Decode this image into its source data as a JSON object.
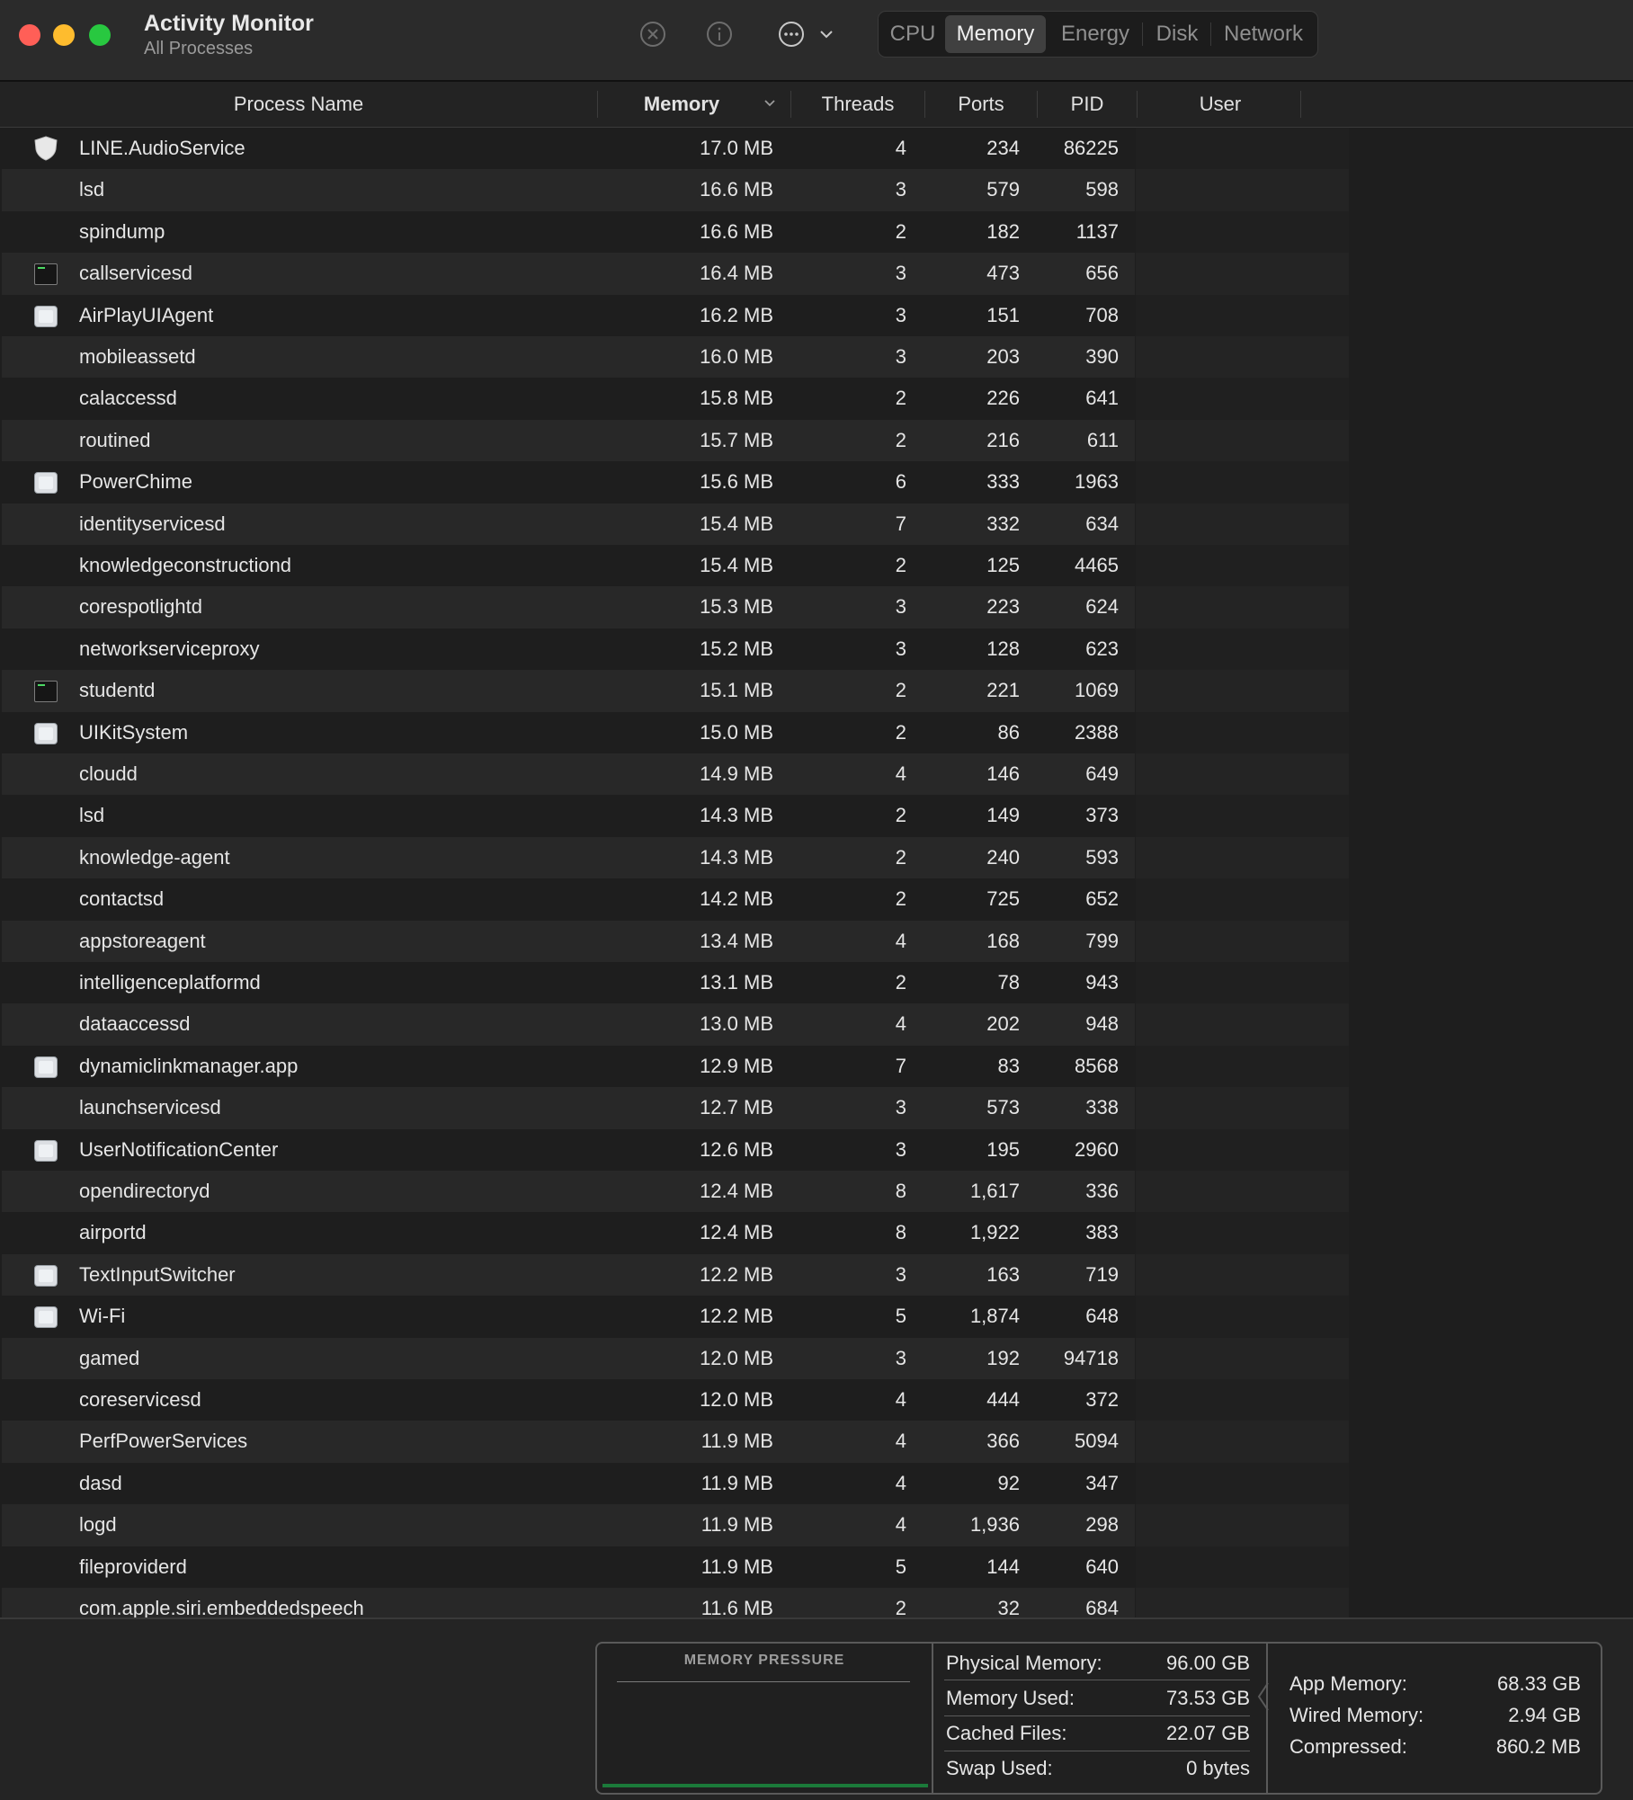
{
  "window": {
    "title": "Activity Monitor",
    "subtitle": "All Processes"
  },
  "toolbar": {
    "icons": [
      "stop-process-icon",
      "info-icon",
      "more-options-icon",
      "chevron-down-icon"
    ],
    "tabs": [
      {
        "label": "CPU",
        "active": false
      },
      {
        "label": "Memory",
        "active": true
      },
      {
        "label": "Energy",
        "active": false
      },
      {
        "label": "Disk",
        "active": false
      },
      {
        "label": "Network",
        "active": false
      }
    ]
  },
  "columns": {
    "name": "Process Name",
    "memory": "Memory",
    "threads": "Threads",
    "ports": "Ports",
    "pid": "PID",
    "user": "User"
  },
  "processes": [
    {
      "name": "LINE.AudioService",
      "icon": "shield-icon",
      "memory": "17.0 MB",
      "threads": "4",
      "ports": "234",
      "pid": "86225"
    },
    {
      "name": "lsd",
      "icon": "",
      "memory": "16.6 MB",
      "threads": "3",
      "ports": "579",
      "pid": "598"
    },
    {
      "name": "spindump",
      "icon": "",
      "memory": "16.6 MB",
      "threads": "2",
      "ports": "182",
      "pid": "1137"
    },
    {
      "name": "callservicesd",
      "icon": "terminal-icon",
      "memory": "16.4 MB",
      "threads": "3",
      "ports": "473",
      "pid": "656"
    },
    {
      "name": "AirPlayUIAgent",
      "icon": "app-icon",
      "memory": "16.2 MB",
      "threads": "3",
      "ports": "151",
      "pid": "708"
    },
    {
      "name": "mobileassetd",
      "icon": "",
      "memory": "16.0 MB",
      "threads": "3",
      "ports": "203",
      "pid": "390"
    },
    {
      "name": "calaccessd",
      "icon": "",
      "memory": "15.8 MB",
      "threads": "2",
      "ports": "226",
      "pid": "641"
    },
    {
      "name": "routined",
      "icon": "",
      "memory": "15.7 MB",
      "threads": "2",
      "ports": "216",
      "pid": "611"
    },
    {
      "name": "PowerChime",
      "icon": "app-icon",
      "memory": "15.6 MB",
      "threads": "6",
      "ports": "333",
      "pid": "1963"
    },
    {
      "name": "identityservicesd",
      "icon": "",
      "memory": "15.4 MB",
      "threads": "7",
      "ports": "332",
      "pid": "634"
    },
    {
      "name": "knowledgeconstructiond",
      "icon": "",
      "memory": "15.4 MB",
      "threads": "2",
      "ports": "125",
      "pid": "4465"
    },
    {
      "name": "corespotlightd",
      "icon": "",
      "memory": "15.3 MB",
      "threads": "3",
      "ports": "223",
      "pid": "624"
    },
    {
      "name": "networkserviceproxy",
      "icon": "",
      "memory": "15.2 MB",
      "threads": "3",
      "ports": "128",
      "pid": "623"
    },
    {
      "name": "studentd",
      "icon": "terminal-icon",
      "memory": "15.1 MB",
      "threads": "2",
      "ports": "221",
      "pid": "1069"
    },
    {
      "name": "UIKitSystem",
      "icon": "app-icon",
      "memory": "15.0 MB",
      "threads": "2",
      "ports": "86",
      "pid": "2388"
    },
    {
      "name": "cloudd",
      "icon": "",
      "memory": "14.9 MB",
      "threads": "4",
      "ports": "146",
      "pid": "649"
    },
    {
      "name": "lsd",
      "icon": "",
      "memory": "14.3 MB",
      "threads": "2",
      "ports": "149",
      "pid": "373"
    },
    {
      "name": "knowledge-agent",
      "icon": "",
      "memory": "14.3 MB",
      "threads": "2",
      "ports": "240",
      "pid": "593"
    },
    {
      "name": "contactsd",
      "icon": "",
      "memory": "14.2 MB",
      "threads": "2",
      "ports": "725",
      "pid": "652"
    },
    {
      "name": "appstoreagent",
      "icon": "",
      "memory": "13.4 MB",
      "threads": "4",
      "ports": "168",
      "pid": "799"
    },
    {
      "name": "intelligenceplatformd",
      "icon": "",
      "memory": "13.1 MB",
      "threads": "2",
      "ports": "78",
      "pid": "943"
    },
    {
      "name": "dataaccessd",
      "icon": "",
      "memory": "13.0 MB",
      "threads": "4",
      "ports": "202",
      "pid": "948"
    },
    {
      "name": "dynamiclinkmanager.app",
      "icon": "app-icon",
      "memory": "12.9 MB",
      "threads": "7",
      "ports": "83",
      "pid": "8568"
    },
    {
      "name": "launchservicesd",
      "icon": "",
      "memory": "12.7 MB",
      "threads": "3",
      "ports": "573",
      "pid": "338"
    },
    {
      "name": "UserNotificationCenter",
      "icon": "app-icon",
      "memory": "12.6 MB",
      "threads": "3",
      "ports": "195",
      "pid": "2960"
    },
    {
      "name": "opendirectoryd",
      "icon": "",
      "memory": "12.4 MB",
      "threads": "8",
      "ports": "1,617",
      "pid": "336"
    },
    {
      "name": "airportd",
      "icon": "",
      "memory": "12.4 MB",
      "threads": "8",
      "ports": "1,922",
      "pid": "383"
    },
    {
      "name": "TextInputSwitcher",
      "icon": "app-icon",
      "memory": "12.2 MB",
      "threads": "3",
      "ports": "163",
      "pid": "719"
    },
    {
      "name": "Wi-Fi",
      "icon": "app-icon",
      "memory": "12.2 MB",
      "threads": "5",
      "ports": "1,874",
      "pid": "648"
    },
    {
      "name": "gamed",
      "icon": "",
      "memory": "12.0 MB",
      "threads": "3",
      "ports": "192",
      "pid": "94718"
    },
    {
      "name": "coreservicesd",
      "icon": "",
      "memory": "12.0 MB",
      "threads": "4",
      "ports": "444",
      "pid": "372"
    },
    {
      "name": "PerfPowerServices",
      "icon": "",
      "memory": "11.9 MB",
      "threads": "4",
      "ports": "366",
      "pid": "5094"
    },
    {
      "name": "dasd",
      "icon": "",
      "memory": "11.9 MB",
      "threads": "4",
      "ports": "92",
      "pid": "347"
    },
    {
      "name": "logd",
      "icon": "",
      "memory": "11.9 MB",
      "threads": "4",
      "ports": "1,936",
      "pid": "298"
    },
    {
      "name": "fileproviderd",
      "icon": "",
      "memory": "11.9 MB",
      "threads": "5",
      "ports": "144",
      "pid": "640"
    },
    {
      "name": "com.apple.siri.embeddedspeech",
      "icon": "",
      "memory": "11.6 MB",
      "threads": "2",
      "ports": "32",
      "pid": "684"
    }
  ],
  "memory_summary": {
    "pressure_title": "MEMORY PRESSURE",
    "pressure_color": "#1b7a3a",
    "physical_memory_label": "Physical Memory:",
    "physical_memory": "96.00 GB",
    "memory_used_label": "Memory Used:",
    "memory_used": "73.53 GB",
    "cached_files_label": "Cached Files:",
    "cached_files": "22.07 GB",
    "swap_used_label": "Swap Used:",
    "swap_used": "0 bytes",
    "app_memory_label": "App Memory:",
    "app_memory": "68.33 GB",
    "wired_memory_label": "Wired Memory:",
    "wired_memory": "2.94 GB",
    "compressed_label": "Compressed:",
    "compressed": "860.2 MB"
  }
}
